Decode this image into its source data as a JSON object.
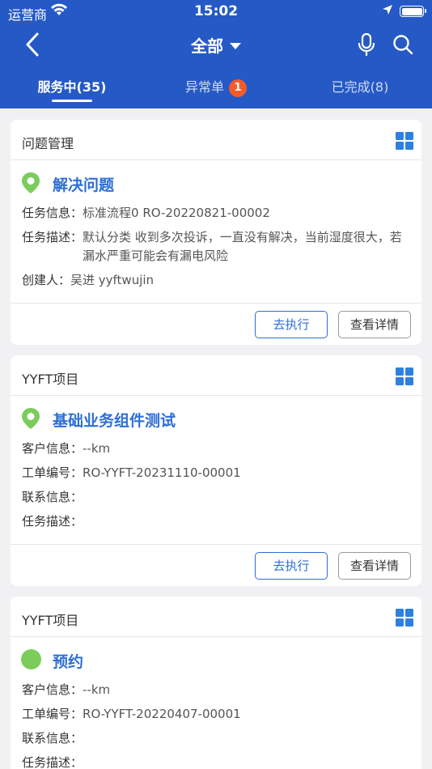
{
  "status_bar": {
    "carrier": "运营商",
    "time": "15:02"
  },
  "nav": {
    "title": "全部"
  },
  "tabs": [
    {
      "label": "服务中(35)",
      "active": true
    },
    {
      "label": "异常单",
      "badge": "1",
      "active": false
    },
    {
      "label": "已完成(8)",
      "active": false
    }
  ],
  "cards": [
    {
      "category": "问题管理",
      "title": "解决问题",
      "title_icon": "location-pin-icon",
      "fields": [
        {
          "key": "任务信息：",
          "value": "标准流程0 RO-20220821-00002"
        },
        {
          "key": "任务描述：",
          "value": "默认分类 收到多次投诉，一直没有解决，当前湿度很大，若漏水严重可能会有漏电风险"
        },
        {
          "key": "创建人：",
          "value": "吴进 yyftwujin"
        }
      ],
      "actions": {
        "execute": "去执行",
        "detail": "查看详情"
      }
    },
    {
      "category": "YYFT项目",
      "title": "基础业务组件测试",
      "title_icon": "location-pin-icon",
      "fields": [
        {
          "key": "客户信息：",
          "value": "--km"
        },
        {
          "key": "工单编号：",
          "value": "RO-YYFT-20231110-00001"
        },
        {
          "key": "联系信息：",
          "value": ""
        },
        {
          "key": "任务描述：",
          "value": ""
        }
      ],
      "actions": {
        "execute": "去执行",
        "detail": "查看详情"
      }
    },
    {
      "category": "YYFT项目",
      "title": "预约",
      "title_icon": "green-dot-icon",
      "fields": [
        {
          "key": "客户信息：",
          "value": "--km"
        },
        {
          "key": "工单编号：",
          "value": "RO-YYFT-20220407-00001"
        },
        {
          "key": "联系信息：",
          "value": ""
        },
        {
          "key": "任务描述：",
          "value": ""
        }
      ]
    }
  ],
  "colors": {
    "header": "#2559c5",
    "accent": "#2d6fd4",
    "badge": "#f45b2a",
    "pin": "#7ccc5c",
    "grid_icon": "#2f7fe0"
  }
}
